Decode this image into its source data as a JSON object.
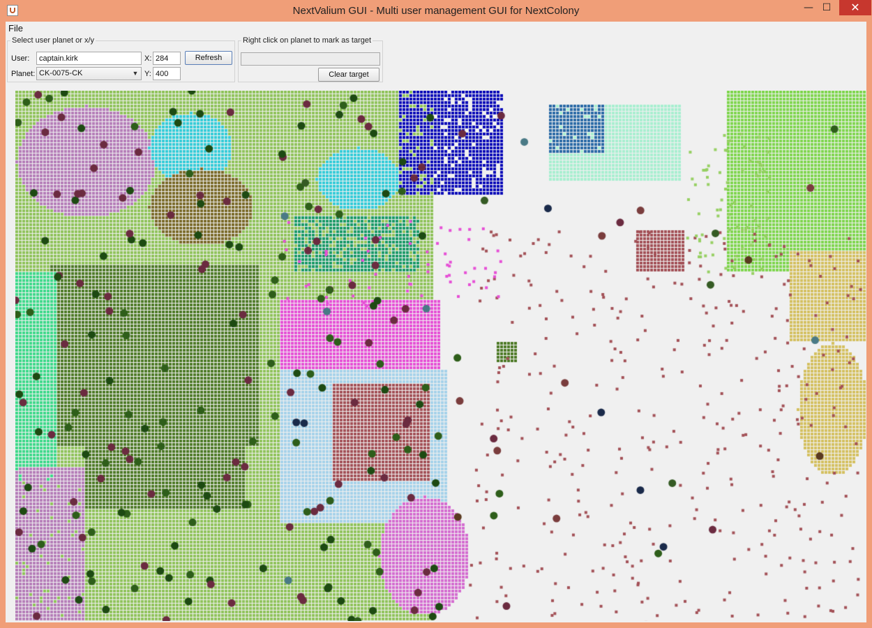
{
  "window": {
    "title": "NextValium GUI - Multi user management GUI for NextColony",
    "minimize_glyph": "—",
    "maximize_glyph": "☐",
    "close_glyph": "✕"
  },
  "menu": {
    "file": "File"
  },
  "select_group": {
    "legend": "Select user planet or x/y",
    "user_label": "User:",
    "user_value": "captain.kirk",
    "x_label": "X:",
    "x_value": "284",
    "y_label": "Y:",
    "y_value": "400",
    "planet_label": "Planet:",
    "planet_value": "CK-0075-CK",
    "refresh_label": "Refresh"
  },
  "target_group": {
    "legend": "Right click on planet to mark as target",
    "target_value": "",
    "clear_label": "Clear target"
  },
  "map": {
    "empty_color": "#f0f0f0",
    "zone_colors": [
      "#8fc35a",
      "#4d7a26",
      "#97d063",
      "#e64fd6",
      "#a6d2ea",
      "#a35157",
      "#c1399f",
      "#0a0ab8",
      "#33ccd8",
      "#1a9a66",
      "#3dd98a",
      "#2a6aa6",
      "#a8efd0",
      "#d4c060",
      "#7fd64e",
      "#b57db8",
      "#7a6a28",
      "#d46cd0"
    ],
    "planet_colors": [
      "#2e5e1a",
      "#1d4a12",
      "#6b2b40",
      "#5a3a20",
      "#4a7a86",
      "#1a2a4a",
      "#355b24",
      "#7a3d3d"
    ]
  }
}
